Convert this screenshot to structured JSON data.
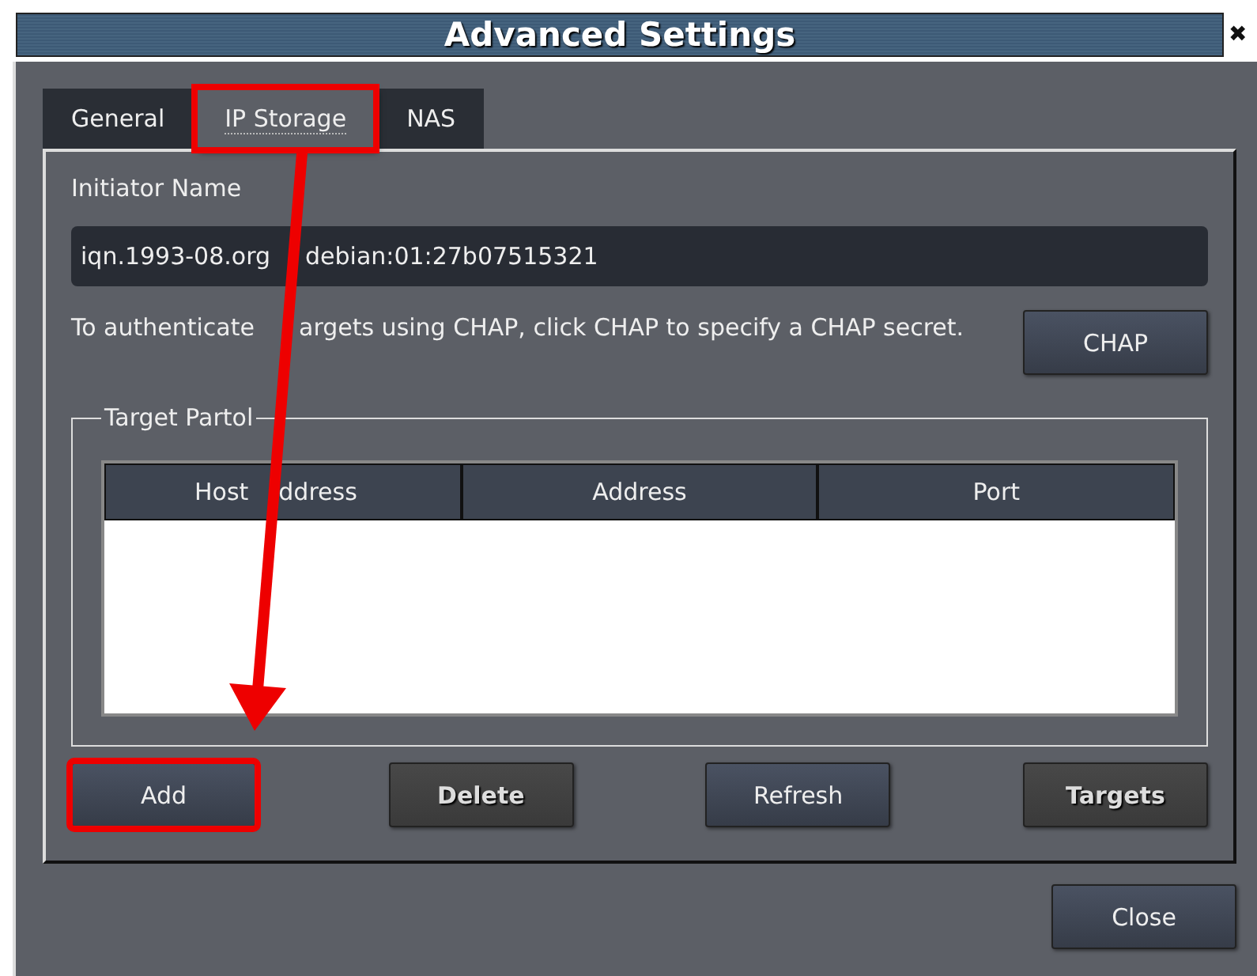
{
  "window": {
    "title": "Advanced Settings",
    "close_glyph": "✖"
  },
  "tabs": [
    {
      "label": "General",
      "selected": false,
      "highlighted": false
    },
    {
      "label": "IP Storage",
      "selected": true,
      "highlighted": true
    },
    {
      "label": "NAS",
      "selected": false,
      "highlighted": false
    }
  ],
  "initiator": {
    "label": "Initiator Name",
    "value_parts": [
      "iqn.1993-08.org",
      "debian:01:27b07515321"
    ]
  },
  "chap": {
    "description_parts": [
      "To authenticate",
      "argets using CHAP, click CHAP to specify a CHAP secret."
    ],
    "button": "CHAP"
  },
  "target_portal": {
    "title": "Target Partol",
    "table": {
      "columns": [
        {
          "parts": [
            "Host",
            "ddress"
          ]
        },
        {
          "parts": [
            "Address"
          ]
        },
        {
          "parts": [
            "Port"
          ]
        }
      ]
    }
  },
  "buttons": [
    {
      "label": "Add",
      "disabled": false,
      "highlighted": true
    },
    {
      "label": "Delete",
      "disabled": true,
      "highlighted": false
    },
    {
      "label": "Refresh",
      "disabled": false,
      "highlighted": false
    },
    {
      "label": "Targets",
      "disabled": true,
      "highlighted": false
    }
  ],
  "close_button": {
    "label": "Close",
    "disabled": false
  }
}
